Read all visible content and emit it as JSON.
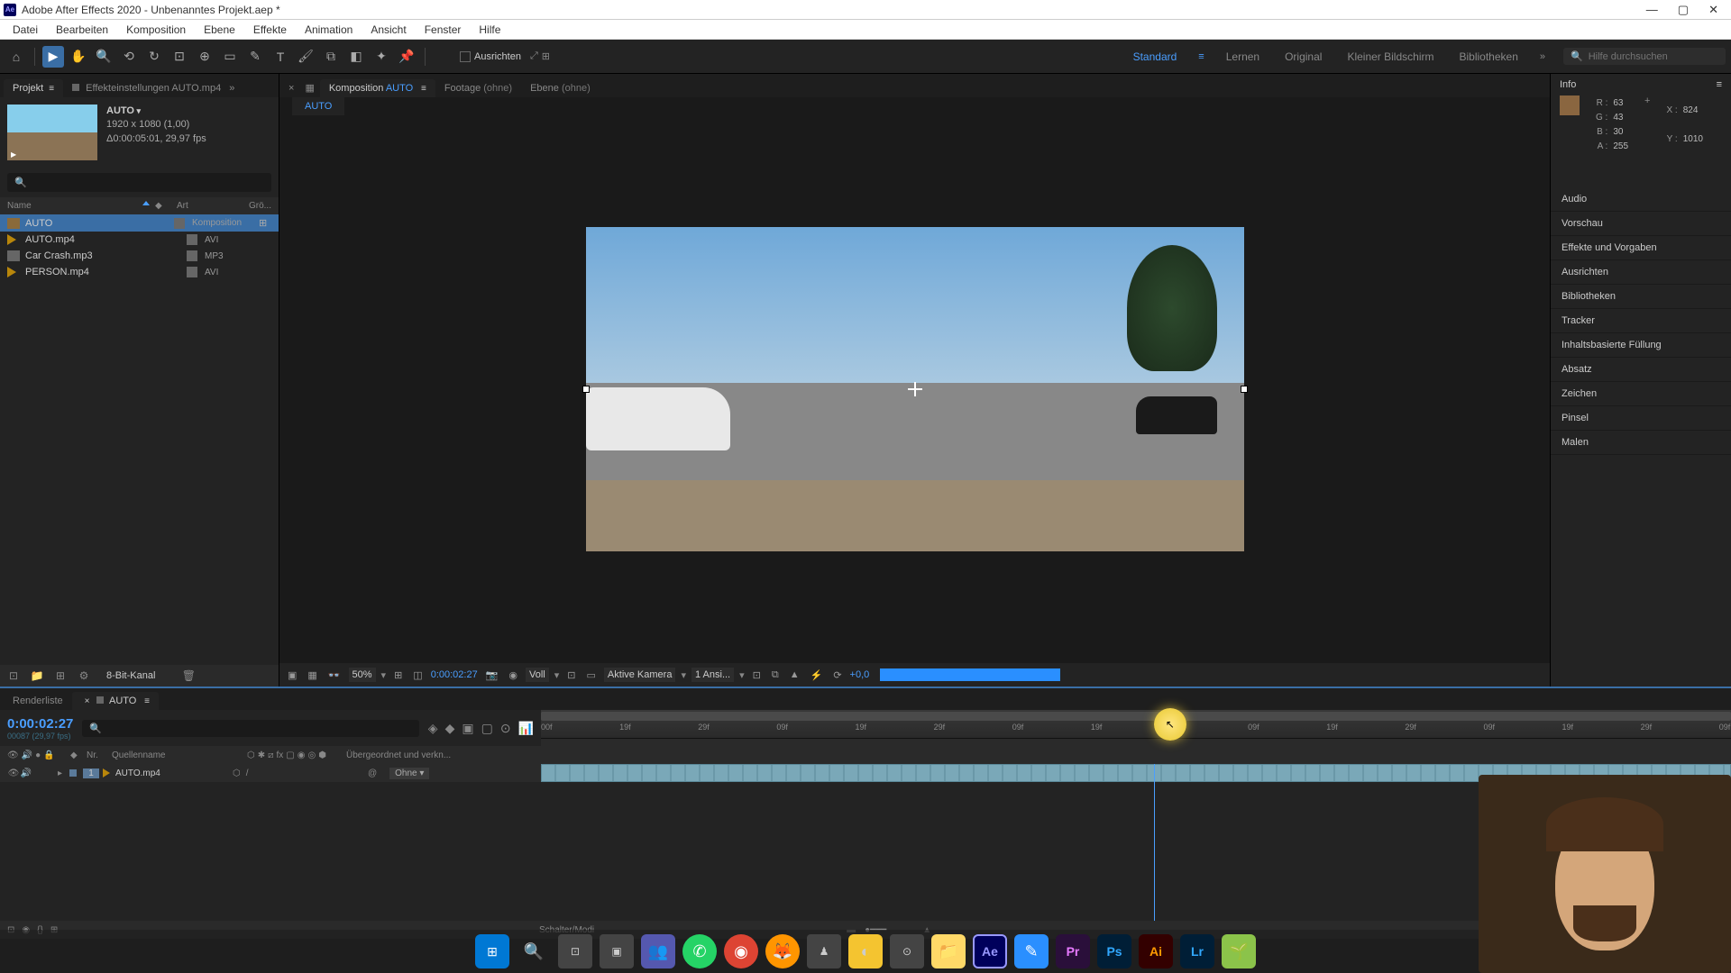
{
  "window": {
    "title": "Adobe After Effects 2020 - Unbenanntes Projekt.aep *"
  },
  "menu": [
    "Datei",
    "Bearbeiten",
    "Komposition",
    "Ebene",
    "Effekte",
    "Animation",
    "Ansicht",
    "Fenster",
    "Hilfe"
  ],
  "workspaces": [
    "Standard",
    "Lernen",
    "Original",
    "Kleiner Bildschirm",
    "Bibliotheken"
  ],
  "workspace_active": "Standard",
  "search_placeholder": "Hilfe durchsuchen",
  "toolbar": {
    "ausrichten": "Ausrichten"
  },
  "project": {
    "tab": "Projekt",
    "tab2_prefix": "Effekteinstellungen",
    "tab2_name": "AUTO.mp4",
    "item_name": "AUTO",
    "dims": "1920 x 1080 (1,00)",
    "dur": "Δ0:00:05:01, 29,97 fps",
    "col_name": "Name",
    "col_type": "Art",
    "col_size": "Grö...",
    "items": [
      {
        "name": "AUTO",
        "type": "Komposition",
        "kind": "comp",
        "selected": true
      },
      {
        "name": "AUTO.mp4",
        "type": "AVI",
        "kind": "video"
      },
      {
        "name": "Car Crash.mp3",
        "type": "MP3",
        "kind": "audio"
      },
      {
        "name": "PERSON.mp4",
        "type": "AVI",
        "kind": "video"
      }
    ],
    "footer_label": "8-Bit-Kanal"
  },
  "comp": {
    "tab_prefix": "Komposition",
    "tab_name": "AUTO",
    "footage_tab": "Footage",
    "ebene_tab": "Ebene",
    "none": "(ohne)",
    "breadcrumb": "AUTO",
    "zoom": "50%",
    "time": "0:00:02:27",
    "res": "Voll",
    "camera": "Aktive Kamera",
    "views": "1 Ansi...",
    "exposure": "+0,0"
  },
  "info": {
    "title": "Info",
    "R": "63",
    "G": "43",
    "B": "30",
    "A": "255",
    "X": "824",
    "Y": "1010"
  },
  "right_panels": [
    "Audio",
    "Vorschau",
    "Effekte und Vorgaben",
    "Ausrichten",
    "Bibliotheken",
    "Tracker",
    "Inhaltsbasierte Füllung",
    "Absatz",
    "Zeichen",
    "Pinsel",
    "Malen"
  ],
  "timeline": {
    "tab_render": "Renderliste",
    "tab_name": "AUTO",
    "time": "0:00:02:27",
    "time_sub": "00087 (29,97 fps)",
    "col_nr": "Nr.",
    "col_source": "Quellenname",
    "col_parent": "Übergeordnet und verkn...",
    "layer_nr": "1",
    "layer_name": "AUTO.mp4",
    "parent_value": "Ohne",
    "footer": "Schalter/Modi",
    "ticks": [
      "00f",
      "19f",
      "29f",
      "09f",
      "19f",
      "29f",
      "09f",
      "19f",
      "29f",
      "09f",
      "19f",
      "29f",
      "09f",
      "19f",
      "29f",
      "09f"
    ]
  }
}
